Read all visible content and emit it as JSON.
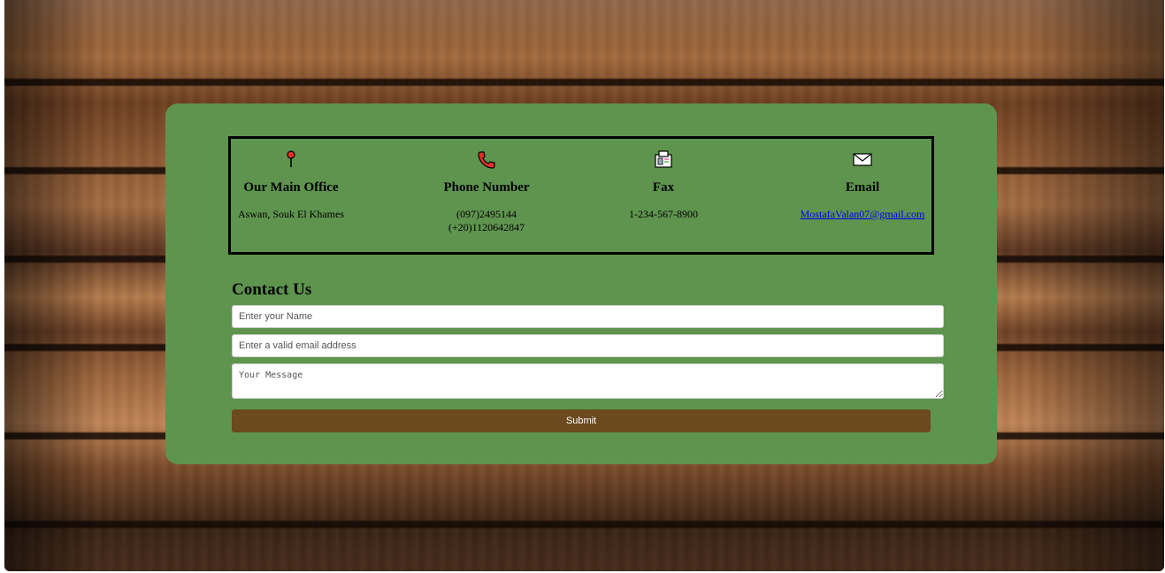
{
  "info": [
    {
      "icon": "map-pin-icon",
      "title": "Our Main Office",
      "lines": [
        "Aswan, Souk El Khames"
      ]
    },
    {
      "icon": "phone-icon",
      "title": "Phone Number",
      "lines": [
        "(097)2495144",
        "(+20)1120642847"
      ]
    },
    {
      "icon": "fax-icon",
      "title": "Fax",
      "lines": [
        "1-234-567-8900"
      ]
    },
    {
      "icon": "envelope-icon",
      "title": "Email",
      "link": "MostafaValan07@gmail.com"
    }
  ],
  "contact": {
    "title": "Contact Us",
    "name_placeholder": "Enter your Name",
    "email_placeholder": "Enter a valid email address",
    "message_placeholder": "Your Message",
    "submit_label": "Submit"
  },
  "colors": {
    "card": "#5e944e",
    "submit": "#6b4a1d"
  }
}
